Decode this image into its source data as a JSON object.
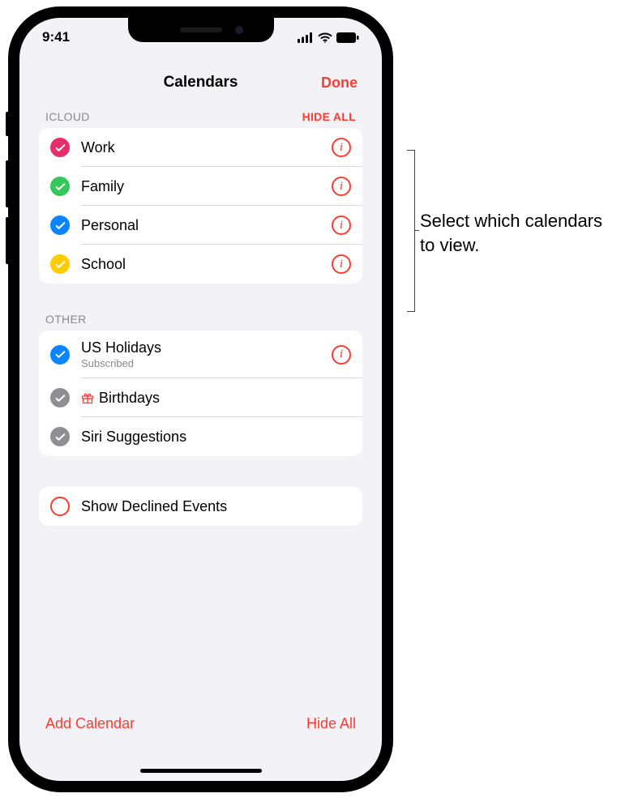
{
  "status_bar": {
    "time": "9:41"
  },
  "sheet": {
    "title": "Calendars",
    "done_label": "Done"
  },
  "sections": {
    "icloud": {
      "label": "ICLOUD",
      "hide_all_label": "HIDE ALL",
      "items": [
        {
          "label": "Work",
          "color": "#e82d6b"
        },
        {
          "label": "Family",
          "color": "#34c759"
        },
        {
          "label": "Personal",
          "color": "#0a84ff"
        },
        {
          "label": "School",
          "color": "#ffcc00"
        }
      ]
    },
    "other": {
      "label": "OTHER",
      "items": [
        {
          "label": "US Holidays",
          "subtitle": "Subscribed",
          "color": "#0a84ff",
          "has_info": true
        },
        {
          "label": "Birthdays",
          "color": "#8e8e93",
          "has_info": false,
          "gift": true
        },
        {
          "label": "Siri Suggestions",
          "color": "#8e8e93",
          "has_info": false
        }
      ]
    }
  },
  "declined": {
    "label": "Show Declined Events"
  },
  "footer": {
    "add_label": "Add Calendar",
    "hide_all_label": "Hide All"
  },
  "callout": {
    "text": "Select which calendars to view."
  }
}
